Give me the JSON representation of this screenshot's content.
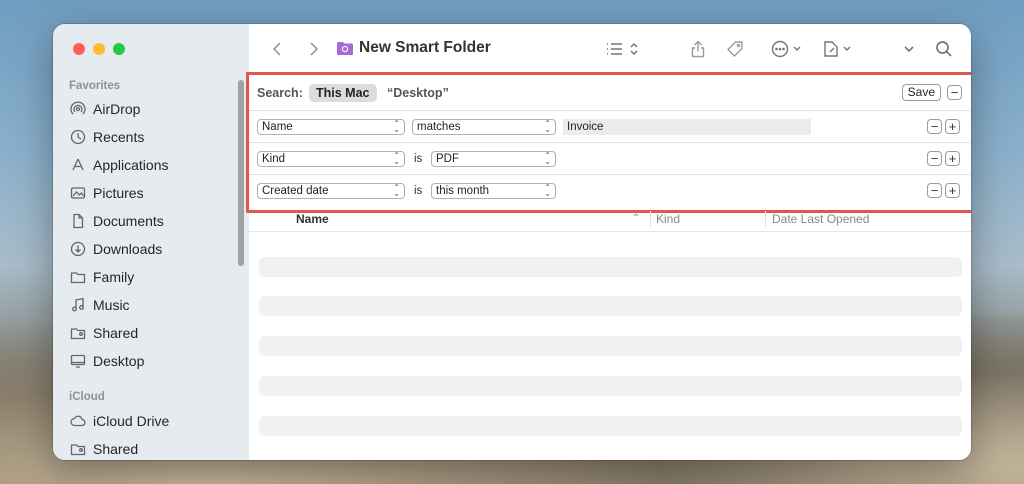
{
  "window": {
    "title": "New Smart Folder"
  },
  "sidebar": {
    "favorites_heading": "Favorites",
    "favorites": [
      {
        "label": "AirDrop",
        "icon": "airdrop-icon"
      },
      {
        "label": "Recents",
        "icon": "clock-icon"
      },
      {
        "label": "Applications",
        "icon": "applications-icon"
      },
      {
        "label": "Pictures",
        "icon": "photo-icon"
      },
      {
        "label": "Documents",
        "icon": "document-icon"
      },
      {
        "label": "Downloads",
        "icon": "download-icon"
      },
      {
        "label": "Family",
        "icon": "folder-icon"
      },
      {
        "label": "Music",
        "icon": "music-note-icon"
      },
      {
        "label": "Shared",
        "icon": "shared-folder-icon"
      },
      {
        "label": "Desktop",
        "icon": "desktop-icon"
      }
    ],
    "icloud_heading": "iCloud",
    "icloud": [
      {
        "label": "iCloud Drive",
        "icon": "cloud-icon"
      },
      {
        "label": "Shared",
        "icon": "shared-folder-icon"
      }
    ]
  },
  "search": {
    "label": "Search:",
    "scope_selected": "This Mac",
    "scope_other": "“Desktop”",
    "save_label": "Save",
    "criteria": [
      {
        "attribute": "Name",
        "operator": "matches",
        "value": "Invoice"
      },
      {
        "attribute": "Kind",
        "operator": "is",
        "value": "PDF"
      },
      {
        "attribute": "Created date",
        "operator": "is",
        "value": "this month"
      }
    ]
  },
  "columns": {
    "name": "Name",
    "kind": "Kind",
    "date_last_opened": "Date Last Opened"
  },
  "colors": {
    "highlight_border": "#e0584c",
    "sidebar_bg": "#e6ebef"
  }
}
